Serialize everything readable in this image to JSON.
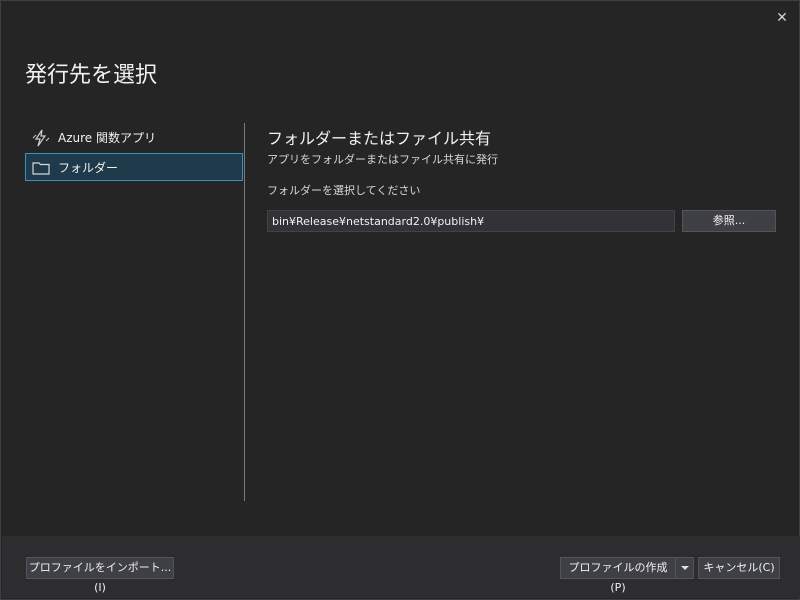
{
  "dialog": {
    "title": "発行先を選択",
    "close_label": "✕"
  },
  "sidebar": {
    "items": [
      {
        "label": "Azure 関数アプリ",
        "icon": "lightning-icon",
        "selected": false
      },
      {
        "label": "フォルダー",
        "icon": "folder-icon",
        "selected": true
      }
    ]
  },
  "main": {
    "heading": "フォルダーまたはファイル共有",
    "subheading": "アプリをフォルダーまたはファイル共有に発行",
    "field_label": "フォルダーを選択してください",
    "path_value": "bin¥Release¥netstandard2.0¥publish¥",
    "browse_label": "参照..."
  },
  "footer": {
    "import_label": "プロファイルをインポート...(I)",
    "create_label": "プロファイルの作成(P)",
    "cancel_label": "キャンセル(C)"
  },
  "colors": {
    "background": "#252526",
    "selection": "#1f3a4a",
    "selection_border": "#3e8fbf"
  }
}
